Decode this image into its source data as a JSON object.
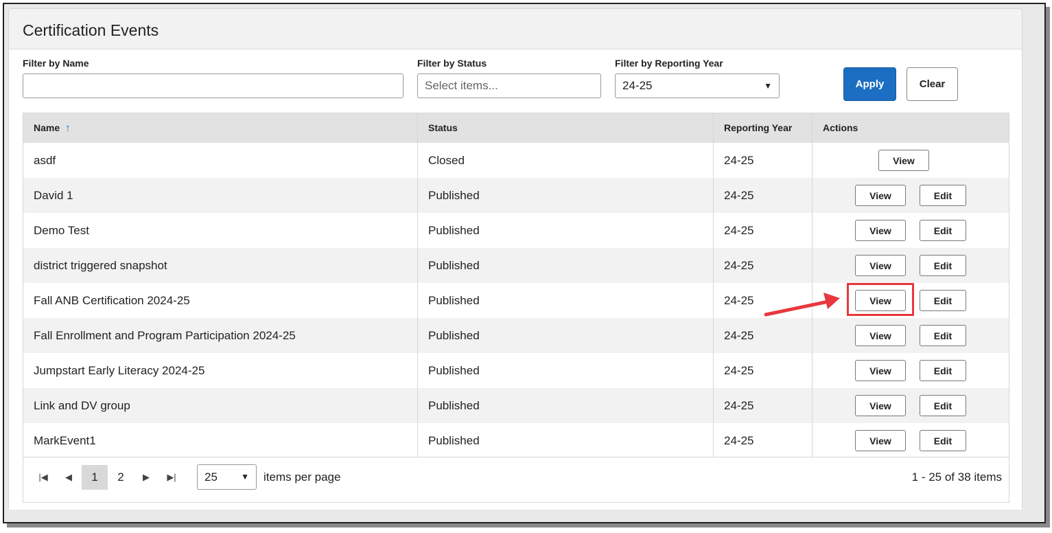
{
  "page": {
    "title": "Certification Events"
  },
  "filters": {
    "name": {
      "label": "Filter by Name",
      "value": ""
    },
    "status": {
      "label": "Filter by Status",
      "placeholder": "Select items..."
    },
    "year": {
      "label": "Filter by Reporting Year",
      "value": "24-25"
    },
    "apply_label": "Apply",
    "clear_label": "Clear"
  },
  "table": {
    "columns": {
      "name": "Name",
      "status": "Status",
      "year": "Reporting Year",
      "actions": "Actions"
    },
    "view_label": "View",
    "edit_label": "Edit",
    "rows": [
      {
        "name": "asdf",
        "status": "Closed",
        "year": "24-25"
      },
      {
        "name": "David 1",
        "status": "Published",
        "year": "24-25"
      },
      {
        "name": "Demo Test",
        "status": "Published",
        "year": "24-25"
      },
      {
        "name": "district triggered snapshot",
        "status": "Published",
        "year": "24-25"
      },
      {
        "name": "Fall ANB Certification 2024-25",
        "status": "Published",
        "year": "24-25"
      },
      {
        "name": "Fall Enrollment and Program Participation 2024-25",
        "status": "Published",
        "year": "24-25"
      },
      {
        "name": "Jumpstart Early Literacy 2024-25",
        "status": "Published",
        "year": "24-25"
      },
      {
        "name": "Link and DV group",
        "status": "Published",
        "year": "24-25"
      },
      {
        "name": "MarkEvent1",
        "status": "Published",
        "year": "24-25"
      }
    ]
  },
  "pager": {
    "pages": [
      "1",
      "2"
    ],
    "current_page": "1",
    "per_page": "25",
    "per_page_label": "items per page",
    "info": "1 - 25 of 38 items"
  },
  "colors": {
    "accent": "#1b6ec2",
    "highlight": "#e8383d"
  }
}
